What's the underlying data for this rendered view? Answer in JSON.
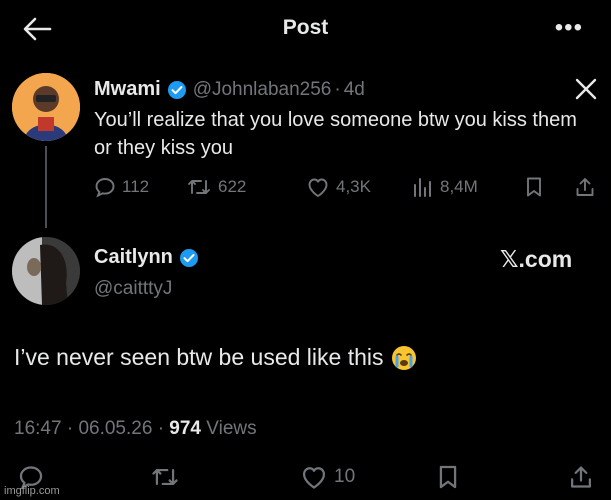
{
  "header": {
    "title": "Post"
  },
  "original_tweet": {
    "name": "Mwami",
    "handle": "@Johnlaban256",
    "separator": "·",
    "time": "4d",
    "text": "You’ll realize that you love someone btw you kiss them or they kiss you",
    "replies": "112",
    "reposts": "622",
    "likes": "4,3K",
    "views": "8,4M"
  },
  "reply_tweet": {
    "name": "Caitlynn",
    "handle": "@caitttyJ",
    "brand": "𝕏.com",
    "text": "I’ve never seen btw be used like this",
    "time": "16:47",
    "date": "06.05.26",
    "separator": "·",
    "views_count": "974",
    "views_label": "Views",
    "likes": "10"
  },
  "watermark": "imgflip.com",
  "colors": {
    "background": "#000000",
    "text": "#e7e9ea",
    "muted": "#71767b",
    "verified": "#1d9bf0"
  }
}
